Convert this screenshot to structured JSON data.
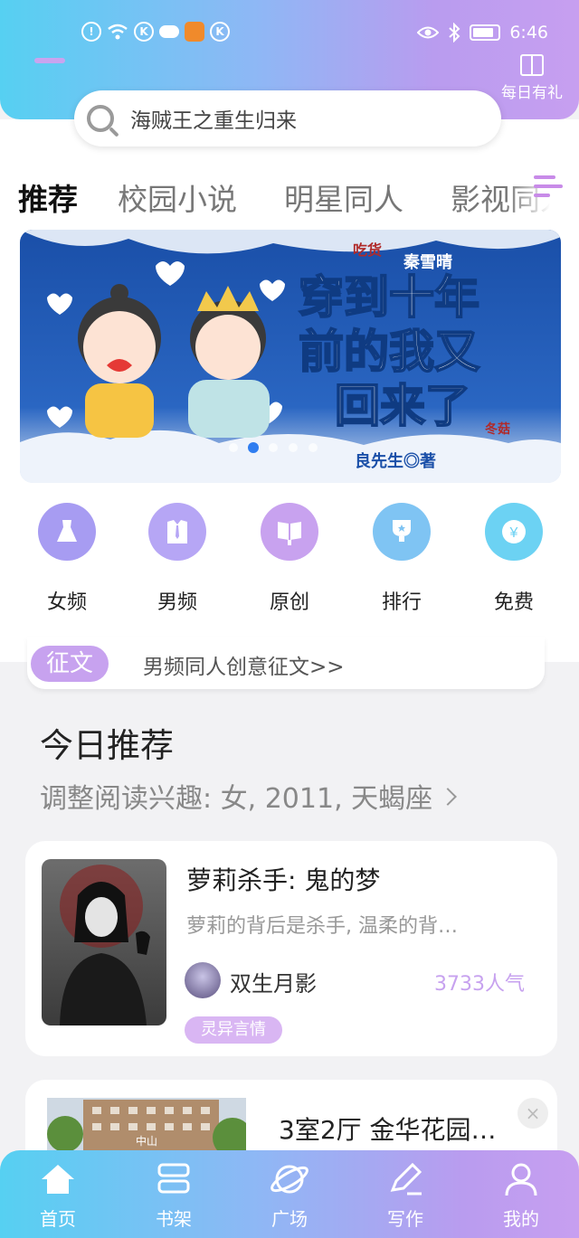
{
  "status_bar": {
    "time": "6:46",
    "left_icons": [
      "alert-icon",
      "wifi-icon",
      "k-icon",
      "cloud-icon",
      "app-icon",
      "k-icon"
    ],
    "right_icons": [
      "eye-icon",
      "bluetooth-icon",
      "battery-icon"
    ]
  },
  "header": {
    "gift_label": "每日有礼"
  },
  "search": {
    "text": "海贼王之重生归来"
  },
  "tabs": [
    {
      "label": "推荐",
      "active": true
    },
    {
      "label": "校园小说"
    },
    {
      "label": "明星同人"
    },
    {
      "label": "影视同人"
    }
  ],
  "banner": {
    "tag_left": "吃货",
    "author_top": "秦雪晴",
    "title_line1": "穿到十年",
    "title_line2": "前的我又",
    "title_line3": "回来了",
    "tag_right": "冬菇",
    "credit": "良先生◎著",
    "active_dot": 1,
    "dots": 5
  },
  "categories": [
    {
      "label": "女频",
      "icon": "dress-icon",
      "color": "#a79cf2"
    },
    {
      "label": "男频",
      "icon": "shirt-icon",
      "color": "#b6a6f5"
    },
    {
      "label": "原创",
      "icon": "book-icon",
      "color": "#c8a2ef"
    },
    {
      "label": "排行",
      "icon": "trophy-icon",
      "color": "#7fc4f3"
    },
    {
      "label": "免费",
      "icon": "coin-icon",
      "color": "#6cd2f3"
    }
  ],
  "notice": {
    "badge": "征文",
    "text": "男频同人创意征文>>"
  },
  "recommend": {
    "title": "今日推荐",
    "subtitle": "调整阅读兴趣: 女, 2011, 天蝎座"
  },
  "book": {
    "title": "萝莉杀手: 鬼的梦",
    "description": "萝莉的背后是杀手, 温柔的背…",
    "author": "双生月影",
    "popularity": "3733人气",
    "tag": "灵异言情"
  },
  "ad": {
    "title": "3室2厅 金华花园…",
    "image_caption": "中山",
    "close": "×"
  },
  "bottom_nav": [
    {
      "label": "首页",
      "icon": "home-icon",
      "active": true
    },
    {
      "label": "书架",
      "icon": "bookshelf-icon"
    },
    {
      "label": "广场",
      "icon": "planet-icon"
    },
    {
      "label": "写作",
      "icon": "pen-icon"
    },
    {
      "label": "我的",
      "icon": "user-icon"
    }
  ]
}
